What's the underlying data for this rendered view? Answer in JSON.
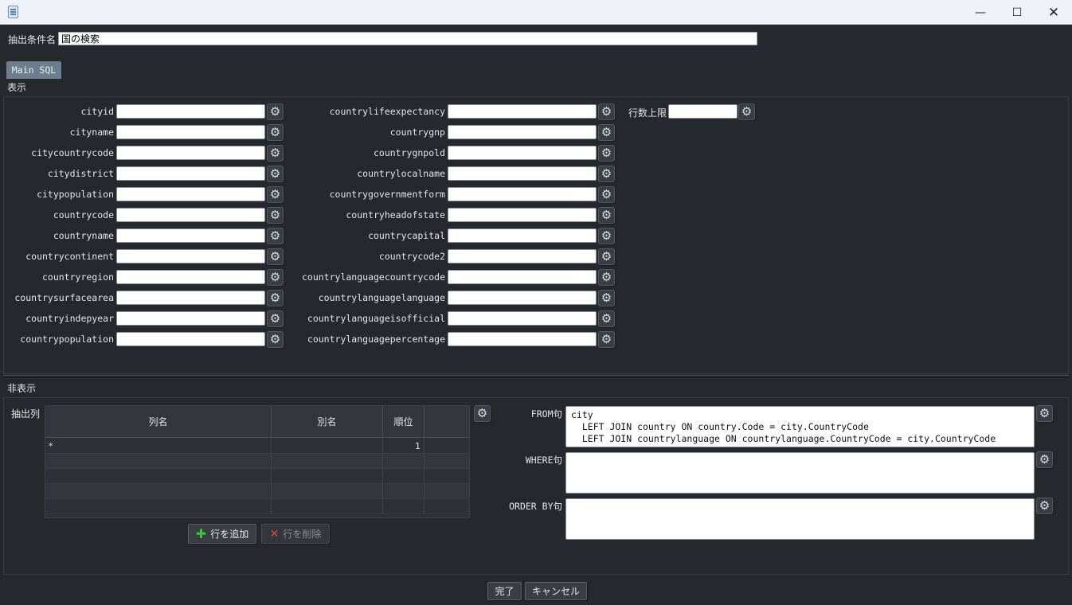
{
  "window": {
    "minimize": "—",
    "maximize": "☐",
    "close": "✕"
  },
  "condition": {
    "label": "抽出条件名",
    "value": "国の検索"
  },
  "tabs": [
    {
      "label": "Main SQL"
    }
  ],
  "display_section": {
    "title": "表示"
  },
  "fields_col1": [
    "cityid",
    "cityname",
    "citycountrycode",
    "citydistrict",
    "citypopulation",
    "countrycode",
    "countryname",
    "countrycontinent",
    "countryregion",
    "countrysurfacearea",
    "countryindepyear",
    "countrypopulation"
  ],
  "fields_col2": [
    "countrylifeexpectancy",
    "countrygnp",
    "countrygnpold",
    "countrylocalname",
    "countrygovernmentform",
    "countryheadofstate",
    "countrycapital",
    "countrycode2",
    "countrylanguagecountrycode",
    "countrylanguagelanguage",
    "countrylanguageisofficial",
    "countrylanguagepercentage"
  ],
  "row_limit": {
    "label": "行数上限",
    "value": ""
  },
  "hidden_section": {
    "title": "非表示",
    "extract_label": "抽出列",
    "columns": [
      "列名",
      "別名",
      "順位",
      ""
    ],
    "rows": [
      [
        "*",
        "",
        "1",
        ""
      ]
    ],
    "add_row_label": "行を追加",
    "delete_row_label": "行を削除"
  },
  "sql": {
    "from_label": "FROM句",
    "from_value": "city\n  LEFT JOIN country ON country.Code = city.CountryCode\n  LEFT JOIN countrylanguage ON countrylanguage.CountryCode = city.CountryCode",
    "where_label": "WHERE句",
    "where_value": "",
    "orderby_label": "ORDER BY句",
    "orderby_value": ""
  },
  "footer": {
    "ok_label": "完了",
    "cancel_label": "キャンセル"
  },
  "icons": {
    "settings": "gear-icon",
    "app": "document-icon",
    "add": "plus-icon",
    "delete": "x-icon"
  },
  "colors": {
    "background": "#25282d",
    "tab": "#6b7f8e",
    "add_icon": "#3cc23c",
    "delete_icon": "#d24a4a"
  }
}
